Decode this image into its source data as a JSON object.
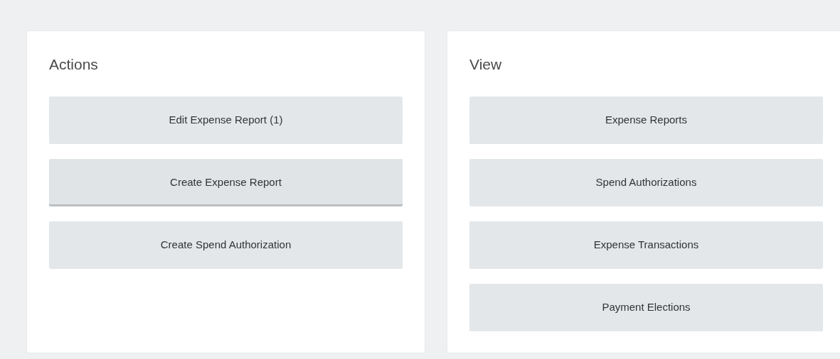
{
  "panels": [
    {
      "title": "Actions",
      "buttons": [
        {
          "label": "Edit Expense Report (1)",
          "hovered": false
        },
        {
          "label": "Create Expense Report",
          "hovered": true
        },
        {
          "label": "Create Spend Authorization",
          "hovered": false
        }
      ]
    },
    {
      "title": "View",
      "buttons": [
        {
          "label": "Expense Reports",
          "hovered": false
        },
        {
          "label": "Spend Authorizations",
          "hovered": false
        },
        {
          "label": "Expense Transactions",
          "hovered": false
        },
        {
          "label": "Payment Elections",
          "hovered": false
        }
      ]
    }
  ]
}
